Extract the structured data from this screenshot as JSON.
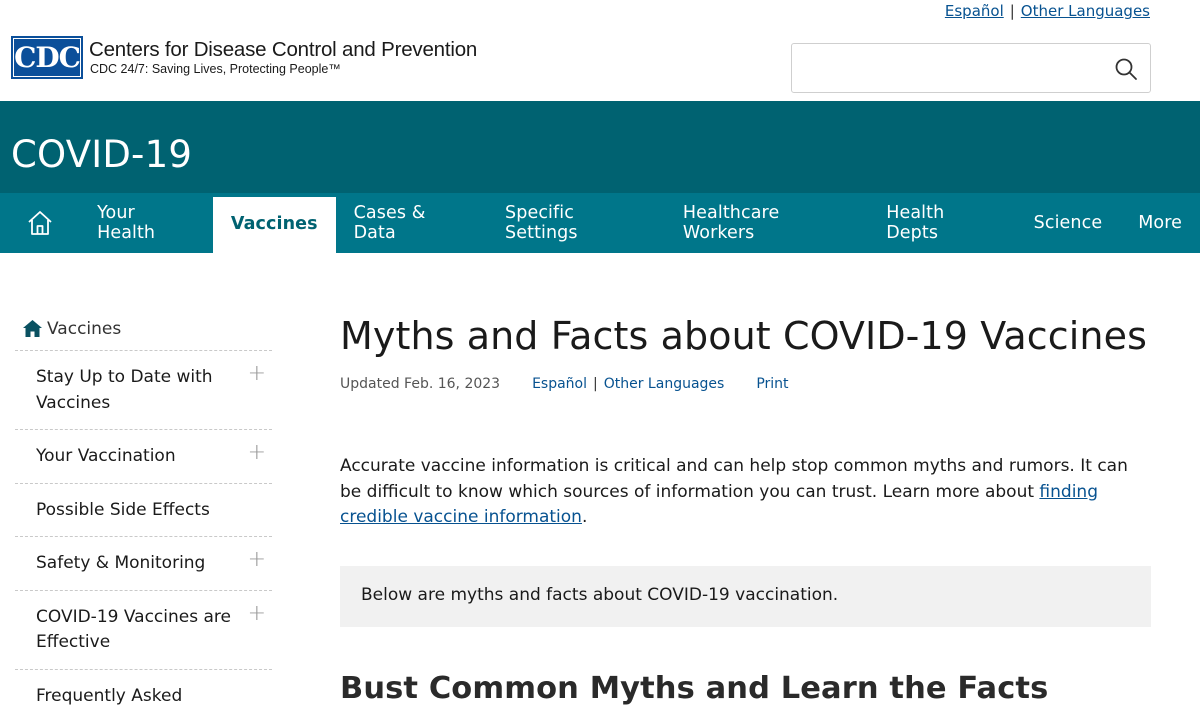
{
  "util": {
    "espanol": "Español",
    "other_languages": "Other Languages",
    "sep": "|"
  },
  "header": {
    "logo_text": "CDC",
    "title": "Centers for Disease Control and Prevention",
    "subtitle": "CDC 24/7: Saving Lives, Protecting People™",
    "search_placeholder": ""
  },
  "banner": {
    "title": "COVID-19"
  },
  "nav": {
    "items": [
      "Your Health",
      "Vaccines",
      "Cases & Data",
      "Specific Settings",
      "Healthcare Workers",
      "Health Depts",
      "Science",
      "More"
    ],
    "active_index": 1
  },
  "sidebar": {
    "head": "Vaccines",
    "items": [
      {
        "label": "Stay Up to Date with Vaccines",
        "expandable": "+"
      },
      {
        "label": "Your Vaccination",
        "expandable": "+"
      },
      {
        "label": "Possible Side Effects",
        "expandable": ""
      },
      {
        "label": "Safety & Monitoring",
        "expandable": "+"
      },
      {
        "label": "COVID-19 Vaccines are Effective",
        "expandable": "+"
      },
      {
        "label": "Frequently Asked",
        "expandable": ""
      }
    ]
  },
  "main": {
    "title": "Myths and Facts about COVID-19 Vaccines",
    "updated": "Updated Feb. 16, 2023",
    "espanol": "Español",
    "sep": "|",
    "other_languages": "Other Languages",
    "print": "Print",
    "intro_text": "Accurate vaccine information is critical and can help stop common myths and rumors. It can be difficult to know which sources of information you can trust. Learn more about ",
    "intro_link": "finding credible vaccine information",
    "intro_end": ".",
    "callout": "Below are myths and facts about COVID-19 vaccination.",
    "h2": "Bust Common Myths and Learn the Facts"
  },
  "colors": {
    "banner": "#006271",
    "nav": "#00768a",
    "link": "#075290",
    "logo": "#0b4f9a"
  }
}
